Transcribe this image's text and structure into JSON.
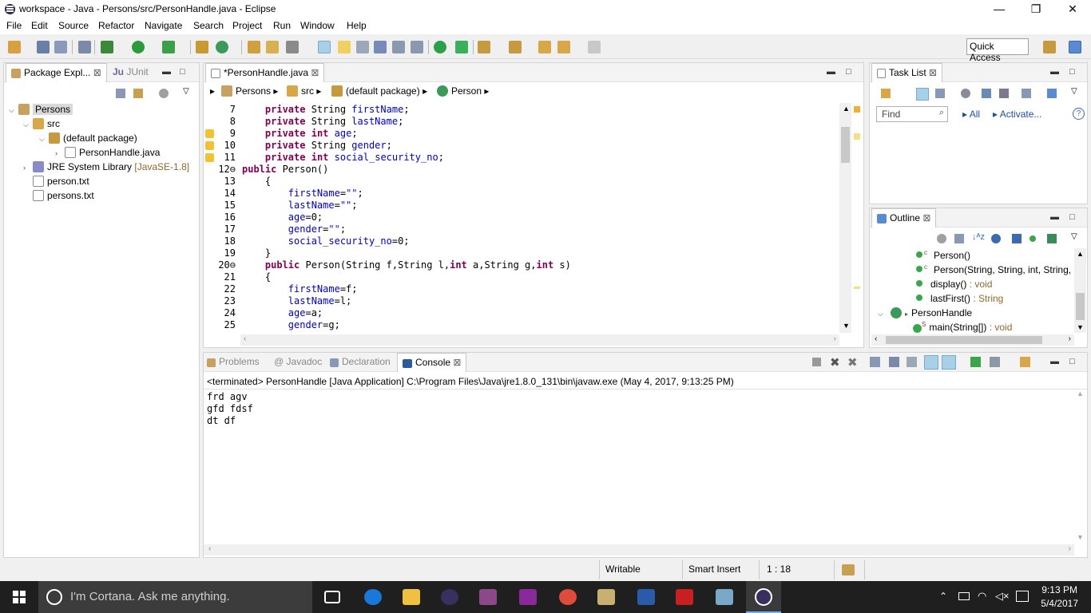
{
  "window": {
    "title": "workspace - Java - Persons/src/PersonHandle.java - Eclipse",
    "minimize_glyph": "—",
    "restore_glyph": "❐",
    "close_glyph": "✕"
  },
  "menu": [
    "File",
    "Edit",
    "Source",
    "Refactor",
    "Navigate",
    "Search",
    "Project",
    "Run",
    "Window",
    "Help"
  ],
  "quick_access": "Quick Access",
  "package_explorer": {
    "tabs": [
      "Package Expl...",
      "JUnit"
    ],
    "tree": [
      {
        "label": "Persons",
        "level": 0,
        "expanded": true,
        "selected": true
      },
      {
        "label": "src",
        "level": 1,
        "expanded": true
      },
      {
        "label": "(default package)",
        "level": 2,
        "expanded": true
      },
      {
        "label": "PersonHandle.java",
        "level": 3,
        "expanded": false
      },
      {
        "label": "JRE System Library",
        "suffix": "[JavaSE-1.8]",
        "level": 1,
        "expanded": false
      },
      {
        "label": "person.txt",
        "level": 1
      },
      {
        "label": "persons.txt",
        "level": 1
      }
    ]
  },
  "editor": {
    "tab": "*PersonHandle.java",
    "breadcrumb": [
      "Persons",
      "src",
      "(default package)",
      "Person"
    ],
    "lines": [
      {
        "n": "7",
        "code": "    private String firstName;",
        "warn": false
      },
      {
        "n": "8",
        "code": "    private String lastName;",
        "warn": false
      },
      {
        "n": "9",
        "code": "    private int age;",
        "warn": true
      },
      {
        "n": "10",
        "code": "    private String gender;",
        "warn": true
      },
      {
        "n": "11",
        "code": "    private int social_security_no;",
        "warn": true
      },
      {
        "n": "12⊖",
        "code": "public Person()",
        "warn": false
      },
      {
        "n": "13",
        "code": "    {",
        "warn": false
      },
      {
        "n": "14",
        "code": "        firstName=\"\";",
        "warn": false
      },
      {
        "n": "15",
        "code": "        lastName=\"\";",
        "warn": false
      },
      {
        "n": "16",
        "code": "        age=0;",
        "warn": false
      },
      {
        "n": "17",
        "code": "        gender=\"\";",
        "warn": false
      },
      {
        "n": "18",
        "code": "        social_security_no=0;",
        "warn": false
      },
      {
        "n": "19",
        "code": "    }",
        "warn": false
      },
      {
        "n": "20⊖",
        "code": "    public Person(String f,String l,int a,String g,int s)",
        "warn": false
      },
      {
        "n": "21",
        "code": "    {",
        "warn": false
      },
      {
        "n": "22",
        "code": "        firstName=f;",
        "warn": false
      },
      {
        "n": "23",
        "code": "        lastName=l;",
        "warn": false
      },
      {
        "n": "24",
        "code": "        age=a;",
        "warn": false
      },
      {
        "n": "25",
        "code": "        gender=g;",
        "warn": false
      }
    ]
  },
  "task_list": {
    "tab": "Task List",
    "find_placeholder": "Find",
    "all": "All",
    "activate": "Activate..."
  },
  "outline": {
    "tab": "Outline",
    "items": [
      {
        "name": "Person()",
        "type": "",
        "ctor": true
      },
      {
        "name": "Person(String, String, int, String, i",
        "type": "",
        "ctor": true
      },
      {
        "name": "display()",
        "type": " : void",
        "ctor": false
      },
      {
        "name": "lastFirst()",
        "type": " : String",
        "ctor": false
      }
    ],
    "class_name": "PersonHandle",
    "main": {
      "name": "main(String[])",
      "type": " : void"
    }
  },
  "console": {
    "tabs": [
      "Problems",
      "@ Javadoc",
      "Declaration",
      "Console"
    ],
    "header": "<terminated> PersonHandle [Java Application] C:\\Program Files\\Java\\jre1.8.0_131\\bin\\javaw.exe (May 4, 2017, 9:13:25 PM)",
    "output": [
      "frd agv",
      "gfd fdsf",
      "dt df"
    ]
  },
  "status": {
    "writable": "Writable",
    "insert_mode": "Smart Insert",
    "position": "1 : 18"
  },
  "taskbar": {
    "cortana": "I'm Cortana. Ask me anything.",
    "time": "9:13 PM",
    "date": "5/4/2017"
  }
}
